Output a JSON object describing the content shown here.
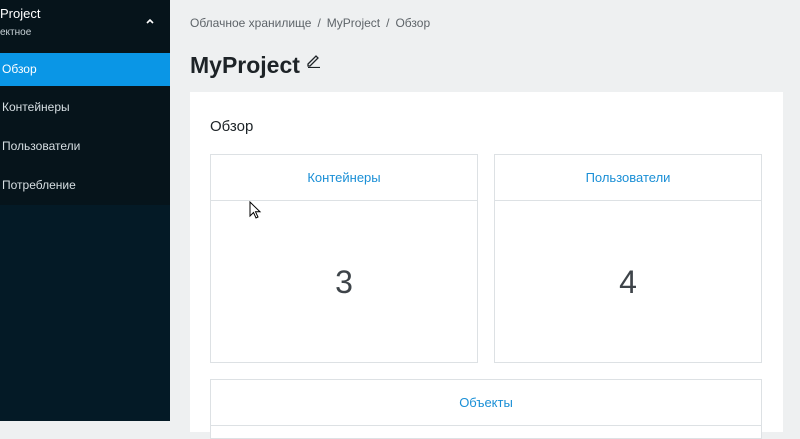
{
  "sidebar": {
    "project_name": "Project",
    "project_type": "ектное",
    "items": [
      {
        "label": "Обзор",
        "active": true
      },
      {
        "label": "Контейнеры",
        "active": false
      },
      {
        "label": "Пользователи",
        "active": false
      },
      {
        "label": "Потребление",
        "active": false
      }
    ],
    "colors": {
      "background": "#041a26",
      "active": "#0a96e6"
    }
  },
  "breadcrumb": [
    "Облачное хранилище",
    "MyProject",
    "Обзор"
  ],
  "page": {
    "title": "MyProject",
    "edit_icon": "pencil-icon",
    "section_title": "Обзор"
  },
  "cards": [
    {
      "label": "Контейнеры",
      "value": "3"
    },
    {
      "label": "Пользователи",
      "value": "4"
    },
    {
      "label": "Объекты",
      "value": ""
    }
  ]
}
